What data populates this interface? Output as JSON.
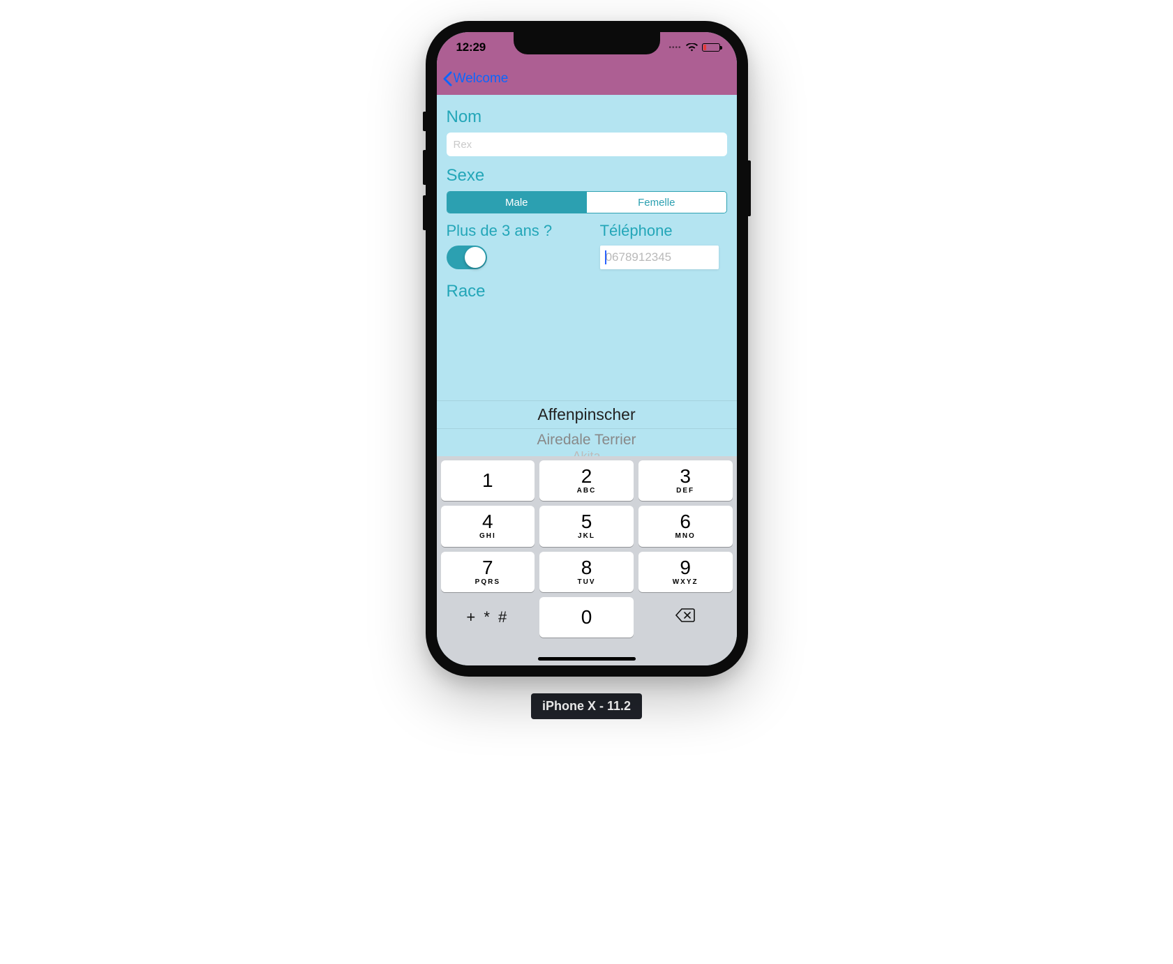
{
  "status": {
    "time": "12:29"
  },
  "nav": {
    "back_label": "Welcome"
  },
  "form": {
    "name_label": "Nom",
    "name_placeholder": "Rex",
    "sex_label": "Sexe",
    "sex_options": {
      "male": "Male",
      "female": "Femelle"
    },
    "age_label": "Plus de 3 ans ?",
    "phone_label": "Téléphone",
    "phone_placeholder": "0678912345",
    "race_label": "Race"
  },
  "picker": {
    "row1": "Affenpinscher",
    "row2": "Airedale Terrier",
    "row3": "Akita"
  },
  "keyboard": {
    "k1": {
      "num": "1",
      "letters": ""
    },
    "k2": {
      "num": "2",
      "letters": "ABC"
    },
    "k3": {
      "num": "3",
      "letters": "DEF"
    },
    "k4": {
      "num": "4",
      "letters": "GHI"
    },
    "k5": {
      "num": "5",
      "letters": "JKL"
    },
    "k6": {
      "num": "6",
      "letters": "MNO"
    },
    "k7": {
      "num": "7",
      "letters": "PQRS"
    },
    "k8": {
      "num": "8",
      "letters": "TUV"
    },
    "k9": {
      "num": "9",
      "letters": "WXYZ"
    },
    "k0": {
      "num": "0",
      "letters": ""
    },
    "symbols": "+ * #"
  },
  "device_label": "iPhone X - 11.2"
}
